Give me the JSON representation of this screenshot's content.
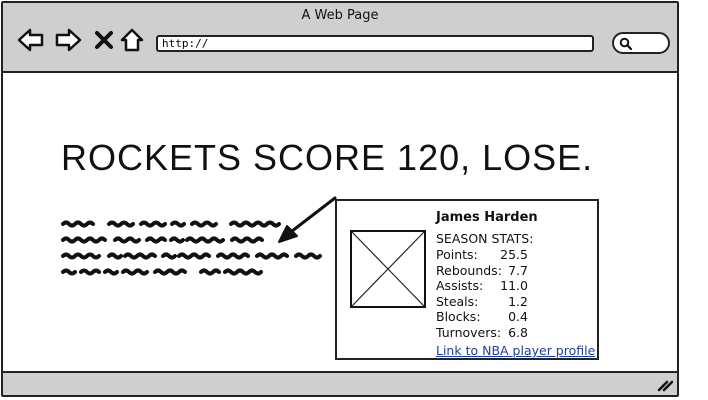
{
  "window": {
    "title": "A Web Page"
  },
  "toolbar": {
    "back_icon": "back-arrow-icon",
    "forward_icon": "forward-arrow-icon",
    "stop_icon": "close-x-icon",
    "home_icon": "home-icon",
    "url_value": "http://",
    "search_icon": "search-icon"
  },
  "page": {
    "headline": "ROCKETS SCORE 120, LOSE.",
    "body_text_placeholder": "scribbled placeholder text (4 lines)"
  },
  "player_card": {
    "name": "James Harden",
    "stats_title": "SEASON STATS:",
    "stats": [
      {
        "label": "Points:",
        "value": "25.5"
      },
      {
        "label": "Rebounds:",
        "value": "7.7"
      },
      {
        "label": "Assists:",
        "value": "11.0"
      },
      {
        "label": "Steals:",
        "value": "1.2"
      },
      {
        "label": "Blocks:",
        "value": "0.4"
      },
      {
        "label": "Turnovers:",
        "value": "6.8"
      }
    ],
    "link_text": "Link to NBA player profile",
    "photo": "image-placeholder-icon"
  },
  "colors": {
    "chrome": "#cfcfcf",
    "border": "#222222",
    "link": "#1a3f9e"
  }
}
